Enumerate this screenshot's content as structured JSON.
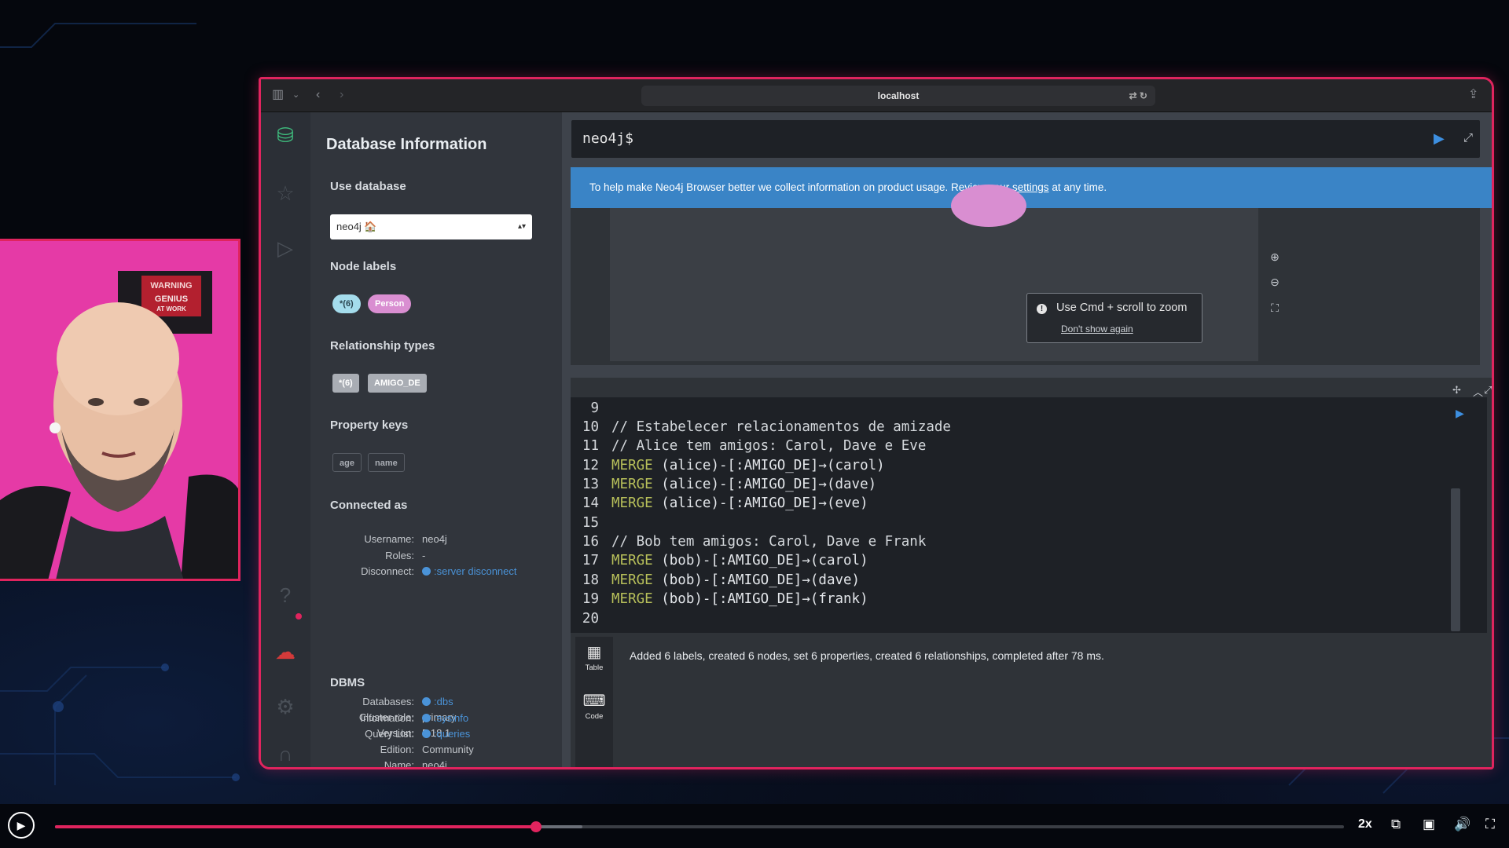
{
  "browser": {
    "url": "localhost"
  },
  "sidebar": {
    "title": "Database Information",
    "use_database_label": "Use database",
    "selected_database": "neo4j 🏠",
    "node_labels_heading": "Node labels",
    "node_labels": [
      "*(6)",
      "Person"
    ],
    "relationship_types_heading": "Relationship types",
    "relationship_types": [
      "*(6)",
      "AMIGO_DE"
    ],
    "property_keys_heading": "Property keys",
    "property_keys": [
      "age",
      "name"
    ],
    "connected_as_heading": "Connected as",
    "connection": [
      {
        "key": "Username:",
        "value": "neo4j"
      },
      {
        "key": "Roles:",
        "value": "-"
      },
      {
        "key": "Disconnect:",
        "value": ":server disconnect"
      }
    ],
    "dbms_heading": "DBMS",
    "dbms": [
      {
        "key": "Cluster role:",
        "value": "primary"
      },
      {
        "key": "Version:",
        "value": "5.18.1"
      },
      {
        "key": "Edition:",
        "value": "Community"
      },
      {
        "key": "Name:",
        "value": "neo4j"
      },
      {
        "key": "Databases:",
        "value": ":dbs"
      },
      {
        "key": "Information:",
        "value": ":sysinfo"
      },
      {
        "key": "Query List:",
        "value": ":queries"
      }
    ]
  },
  "editor": {
    "prompt": "neo4j$"
  },
  "banner": {
    "text_before": "To help make Neo4j Browser better we collect information on product usage. Review your ",
    "link": "settings",
    "text_after": " at any time."
  },
  "zoom_tooltip": {
    "text": "Use Cmd + scroll to zoom",
    "dismiss": "Don't show again"
  },
  "code": {
    "lines": [
      {
        "n": "9",
        "text": ""
      },
      {
        "n": "10",
        "text": "// Estabelecer relacionamentos de amizade"
      },
      {
        "n": "11",
        "text": "// Alice tem amigos: Carol, Dave e Eve"
      },
      {
        "n": "12",
        "kw": "MERGE",
        "text": " (alice)-[:AMIGO_DE]→(carol)"
      },
      {
        "n": "13",
        "kw": "MERGE",
        "text": " (alice)-[:AMIGO_DE]→(dave)"
      },
      {
        "n": "14",
        "kw": "MERGE",
        "text": " (alice)-[:AMIGO_DE]→(eve)"
      },
      {
        "n": "15",
        "text": ""
      },
      {
        "n": "16",
        "text": "// Bob tem amigos: Carol, Dave e Frank"
      },
      {
        "n": "17",
        "kw": "MERGE",
        "text": " (bob)-[:AMIGO_DE]→(carol)"
      },
      {
        "n": "18",
        "kw": "MERGE",
        "text": " (bob)-[:AMIGO_DE]→(dave)"
      },
      {
        "n": "19",
        "kw": "MERGE",
        "text": " (bob)-[:AMIGO_DE]→(frank)"
      },
      {
        "n": "20",
        "text": ""
      }
    ]
  },
  "result": {
    "tabs": [
      "Table",
      "Code"
    ],
    "summary": "Added 6 labels, created 6 nodes, set 6 properties, created 6 relationships, completed after 78 ms."
  },
  "webcam": {
    "sign_line1": "WARNING",
    "sign_line2": "GENIUS",
    "sign_line3": "AT WORK"
  },
  "player": {
    "speed": "2x",
    "progress": 0.373,
    "buffered": 0.409
  },
  "colors": {
    "accent": "#e0245e",
    "banner": "#3a84c6",
    "keyword": "#b7bf5a",
    "link": "#4a93d8"
  }
}
